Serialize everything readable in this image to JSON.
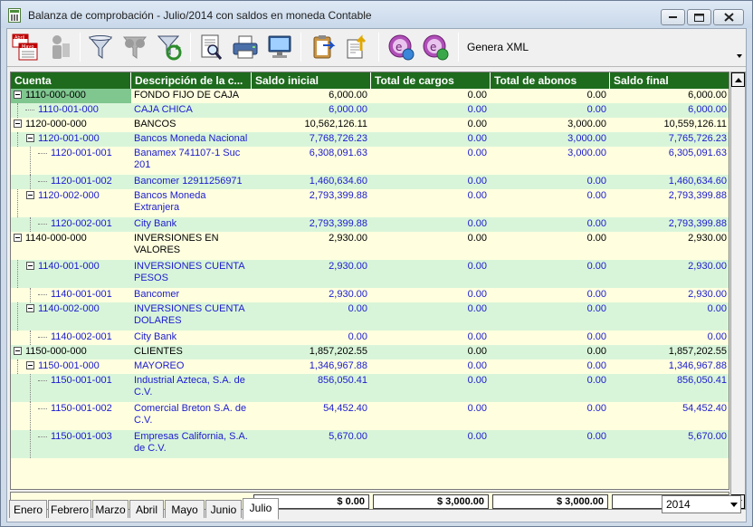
{
  "window": {
    "title": "Balanza de comprobación - Julio/2014 con saldos en moneda Contable"
  },
  "toolbar": {
    "xml_label": "Genera XML",
    "calendar_icon_month_top": "Abril",
    "calendar_icon_month_bottom": "Mayo"
  },
  "grid": {
    "headers": [
      "Cuenta",
      "Descripción de la c...",
      "Saldo inicial",
      "Total de cargos",
      "Total de abonos",
      "Saldo final"
    ],
    "rows": [
      {
        "cuenta": "1110-000-000",
        "desc": "FONDO FIJO DE CAJA",
        "saldo_inicial": "6,000.00",
        "cargos": "0.00",
        "abonos": "0.00",
        "saldo_final": "6,000.00"
      },
      {
        "cuenta": "1110-001-000",
        "desc": "CAJA CHICA",
        "saldo_inicial": "6,000.00",
        "cargos": "0.00",
        "abonos": "0.00",
        "saldo_final": "6,000.00"
      },
      {
        "cuenta": "1120-000-000",
        "desc": "BANCOS",
        "saldo_inicial": "10,562,126.11",
        "cargos": "0.00",
        "abonos": "3,000.00",
        "saldo_final": "10,559,126.11"
      },
      {
        "cuenta": "1120-001-000",
        "desc": "Bancos Moneda Nacional",
        "saldo_inicial": "7,768,726.23",
        "cargos": "0.00",
        "abonos": "3,000.00",
        "saldo_final": "7,765,726.23"
      },
      {
        "cuenta": "1120-001-001",
        "desc": "Banamex 741107-1 Suc 201",
        "saldo_inicial": "6,308,091.63",
        "cargos": "0.00",
        "abonos": "3,000.00",
        "saldo_final": "6,305,091.63"
      },
      {
        "cuenta": "1120-001-002",
        "desc": "Bancomer 12911256971",
        "saldo_inicial": "1,460,634.60",
        "cargos": "0.00",
        "abonos": "0.00",
        "saldo_final": "1,460,634.60"
      },
      {
        "cuenta": "1120-002-000",
        "desc": "Bancos Moneda Extranjera",
        "saldo_inicial": "2,793,399.88",
        "cargos": "0.00",
        "abonos": "0.00",
        "saldo_final": "2,793,399.88"
      },
      {
        "cuenta": "1120-002-001",
        "desc": "City Bank",
        "saldo_inicial": "2,793,399.88",
        "cargos": "0.00",
        "abonos": "0.00",
        "saldo_final": "2,793,399.88"
      },
      {
        "cuenta": "1140-000-000",
        "desc": "INVERSIONES EN VALORES",
        "saldo_inicial": "2,930.00",
        "cargos": "0.00",
        "abonos": "0.00",
        "saldo_final": "2,930.00"
      },
      {
        "cuenta": "1140-001-000",
        "desc": "INVERSIONES CUENTA PESOS",
        "saldo_inicial": "2,930.00",
        "cargos": "0.00",
        "abonos": "0.00",
        "saldo_final": "2,930.00"
      },
      {
        "cuenta": "1140-001-001",
        "desc": "Bancomer",
        "saldo_inicial": "2,930.00",
        "cargos": "0.00",
        "abonos": "0.00",
        "saldo_final": "2,930.00"
      },
      {
        "cuenta": "1140-002-000",
        "desc": "INVERSIONES CUENTA DOLARES",
        "saldo_inicial": "0.00",
        "cargos": "0.00",
        "abonos": "0.00",
        "saldo_final": "0.00"
      },
      {
        "cuenta": "1140-002-001",
        "desc": "City Bank",
        "saldo_inicial": "0.00",
        "cargos": "0.00",
        "abonos": "0.00",
        "saldo_final": "0.00"
      },
      {
        "cuenta": "1150-000-000",
        "desc": "CLIENTES",
        "saldo_inicial": "1,857,202.55",
        "cargos": "0.00",
        "abonos": "0.00",
        "saldo_final": "1,857,202.55"
      },
      {
        "cuenta": "1150-001-000",
        "desc": "MAYOREO",
        "saldo_inicial": "1,346,967.88",
        "cargos": "0.00",
        "abonos": "0.00",
        "saldo_final": "1,346,967.88"
      },
      {
        "cuenta": "1150-001-001",
        "desc": "Industrial Azteca, S.A. de C.V.",
        "saldo_inicial": "856,050.41",
        "cargos": "0.00",
        "abonos": "0.00",
        "saldo_final": "856,050.41"
      },
      {
        "cuenta": "1150-001-002",
        "desc": "Comercial Breton S.A. de C.V.",
        "saldo_inicial": "54,452.40",
        "cargos": "0.00",
        "abonos": "0.00",
        "saldo_final": "54,452.40"
      },
      {
        "cuenta": "1150-001-003",
        "desc": "Empresas California, S.A. de C.V.",
        "saldo_inicial": "5,670.00",
        "cargos": "0.00",
        "abonos": "0.00",
        "saldo_final": "5,670.00"
      }
    ]
  },
  "totals": {
    "saldo_inicial": "$ 0.00",
    "cargos": "$ 3,000.00",
    "abonos": "$ 3,000.00",
    "saldo_final": "$ 0.00"
  },
  "tabs": [
    "Enero",
    "Febrero",
    "Marzo",
    "Abril",
    "Mayo",
    "Junio",
    "Julio"
  ],
  "active_tab": "Julio",
  "year": {
    "selected": "2014"
  },
  "colors": {
    "header_bg": "#1e6b1e",
    "row_odd": "#ffffe0",
    "row_even": "#d9f5d9",
    "sub_text": "#1a1ad0",
    "selected_cell": "#7fc78f"
  }
}
